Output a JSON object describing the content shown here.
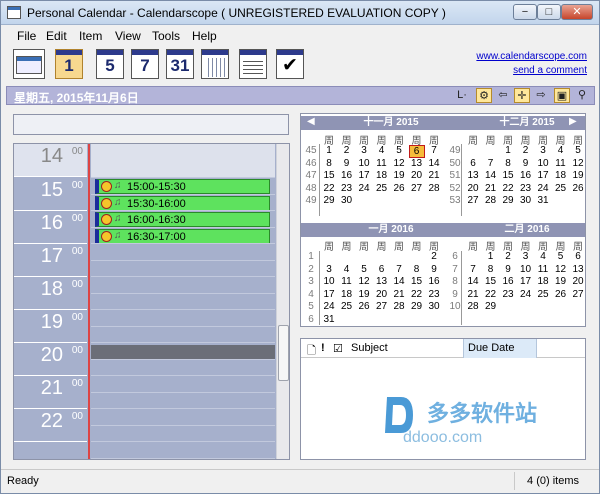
{
  "window": {
    "title": "Personal Calendar - Calendarscope ( UNREGISTERED EVALUATION COPY )",
    "min_label": "−",
    "max_label": "□",
    "close_label": "✕"
  },
  "menu": [
    {
      "label": "File"
    },
    {
      "label": "Edit"
    },
    {
      "label": "Item"
    },
    {
      "label": "View"
    },
    {
      "label": "Tools"
    },
    {
      "label": "Help"
    }
  ],
  "toolbar": {
    "buttons": [
      {
        "name": "new-item",
        "icon": "new-calendar-icon"
      },
      {
        "name": "day-view",
        "label": "1",
        "selected": true
      },
      {
        "name": "work-week-view",
        "label": "5"
      },
      {
        "name": "week-view",
        "label": "7"
      },
      {
        "name": "month-view",
        "label": "31"
      },
      {
        "name": "year-view",
        "icon": "grid-icon"
      },
      {
        "name": "list-view",
        "icon": "list-icon"
      },
      {
        "name": "task-view",
        "icon": "checklist-icon"
      }
    ],
    "website_link": "www.calendarscope.com",
    "comment_link": "send a comment"
  },
  "datebar": {
    "date_text": "星期五, 2015年11月6日",
    "l_label": "L·",
    "icons": [
      "gear-icon",
      "back-arrow-icon",
      "today-icon",
      "forward-arrow-icon",
      "calendar-icon",
      "binoculars-icon"
    ]
  },
  "dayview": {
    "hours": [
      {
        "h": "14",
        "m": "00"
      },
      {
        "h": "15",
        "m": "00"
      },
      {
        "h": "16",
        "m": "00"
      },
      {
        "h": "17",
        "m": "00"
      },
      {
        "h": "18",
        "m": "00"
      },
      {
        "h": "19",
        "m": "00"
      },
      {
        "h": "20",
        "m": "00"
      },
      {
        "h": "21",
        "m": "00"
      },
      {
        "h": "22",
        "m": "00"
      }
    ],
    "appointments": [
      {
        "time": "15:00-15:30"
      },
      {
        "time": "15:30-16:00"
      },
      {
        "time": "16:00-16:30"
      },
      {
        "time": "16:30-17:00"
      }
    ]
  },
  "calendar": {
    "dow": [
      "周",
      "周",
      "周",
      "周",
      "周",
      "周",
      "周"
    ],
    "months": [
      {
        "title": "十一月 2015",
        "weeks": [
          "45",
          "46",
          "47",
          "48",
          "49"
        ],
        "rows": [
          [
            "1",
            "2",
            "3",
            "4",
            "5",
            "6",
            "7"
          ],
          [
            "8",
            "9",
            "10",
            "11",
            "12",
            "13",
            "14"
          ],
          [
            "15",
            "16",
            "17",
            "18",
            "19",
            "20",
            "21"
          ],
          [
            "22",
            "23",
            "24",
            "25",
            "26",
            "27",
            "28"
          ],
          [
            "29",
            "30",
            "",
            "",
            "",
            "",
            ""
          ]
        ],
        "today_index": [
          0,
          5
        ]
      },
      {
        "title": "十二月 2015",
        "weeks": [
          "49",
          "50",
          "51",
          "52",
          "53"
        ],
        "rows": [
          [
            "",
            "",
            "1",
            "2",
            "3",
            "4",
            "5"
          ],
          [
            "6",
            "7",
            "8",
            "9",
            "10",
            "11",
            "12"
          ],
          [
            "13",
            "14",
            "15",
            "16",
            "17",
            "18",
            "19"
          ],
          [
            "20",
            "21",
            "22",
            "23",
            "24",
            "25",
            "26"
          ],
          [
            "27",
            "28",
            "29",
            "30",
            "31",
            "",
            ""
          ]
        ]
      },
      {
        "title": "一月 2016",
        "weeks": [
          "1",
          "2",
          "3",
          "4",
          "5",
          "6"
        ],
        "rows": [
          [
            "",
            "",
            "",
            "",
            "",
            "",
            "2"
          ],
          [
            "3",
            "4",
            "5",
            "6",
            "7",
            "8",
            "9"
          ],
          [
            "10",
            "11",
            "12",
            "13",
            "14",
            "15",
            "16"
          ],
          [
            "17",
            "18",
            "19",
            "20",
            "21",
            "22",
            "23"
          ],
          [
            "24",
            "25",
            "26",
            "27",
            "28",
            "29",
            "30"
          ],
          [
            "31",
            "",
            "",
            "",
            "",
            "",
            ""
          ]
        ]
      },
      {
        "title": "二月 2016",
        "weeks": [
          "6",
          "7",
          "8",
          "9",
          "10"
        ],
        "rows": [
          [
            "",
            "1",
            "2",
            "3",
            "4",
            "5",
            "6"
          ],
          [
            "7",
            "8",
            "9",
            "10",
            "11",
            "12",
            "13"
          ],
          [
            "14",
            "15",
            "16",
            "17",
            "18",
            "19",
            "20"
          ],
          [
            "21",
            "22",
            "23",
            "24",
            "25",
            "26",
            "27"
          ],
          [
            "28",
            "29",
            "",
            "",
            "",
            "",
            ""
          ]
        ]
      }
    ]
  },
  "tasks": {
    "subject_header": "Subject",
    "due_header": "Due Date"
  },
  "watermark": {
    "cn": "多多软件站",
    "en": "ddooo.com"
  },
  "status": {
    "left": "Ready",
    "right": "4 (0) items"
  }
}
